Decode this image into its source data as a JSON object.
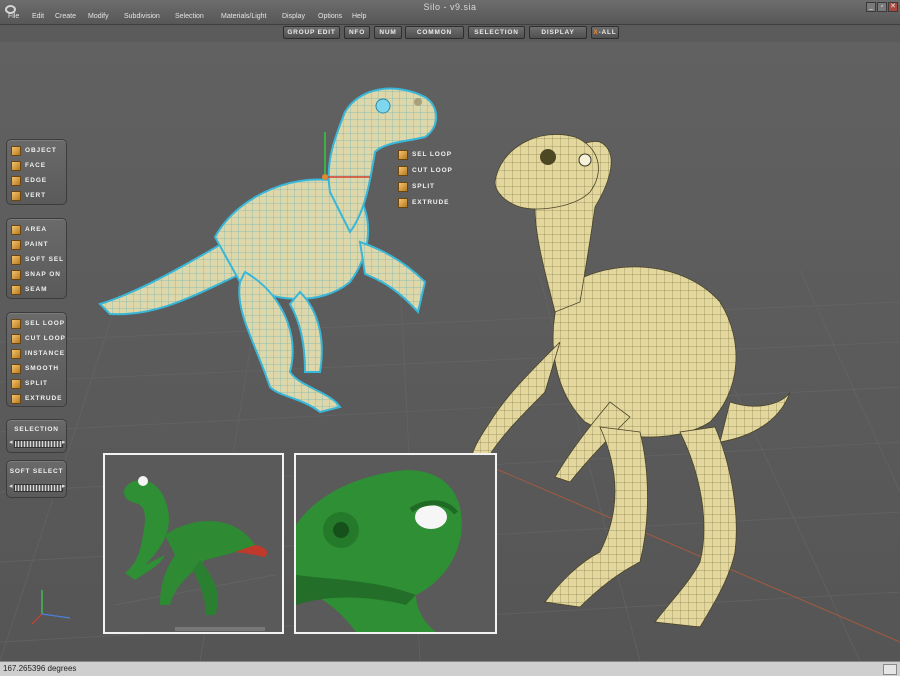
{
  "window": {
    "title": "Silo - v9.sia",
    "minimize": "_",
    "restore": "▫",
    "close": "✕"
  },
  "menu": [
    "File",
    "Edit",
    "Create",
    "Modify",
    "Subdivision",
    "Selection",
    "Materials/Light",
    "Display",
    "Options",
    "Help"
  ],
  "toolbar": {
    "group_edit": "GROUP EDIT",
    "info": "NFO",
    "num": "NUM",
    "common": "COMMON",
    "selection": "SELECTION",
    "display": "DISPLAY",
    "x_all_prefix": "X",
    "x_all_suffix": "-ALL"
  },
  "panels": {
    "modes": [
      "OBJECT",
      "FACE",
      "EDGE",
      "VERT"
    ],
    "select_tools": [
      "AREA",
      "PAINT",
      "SOFT SEL",
      "SNAP ON",
      "SEAM"
    ],
    "edit_tools": [
      "SEL LOOP",
      "CUT LOOP",
      "INSTANCE",
      "SMOOTH",
      "SPLIT",
      "EXTRUDE"
    ],
    "selection_label": "SELECTION",
    "soft_select_label": "SOFT SELECT",
    "slider_left": "◂",
    "slider_right": "▸"
  },
  "context_tools": [
    "SEL LOOP",
    "CUT LOOP",
    "SPLIT",
    "EXTRUDE"
  ],
  "status": {
    "text": "167.265396 degrees"
  },
  "colors": {
    "model_base": "#e3d9a3",
    "model_wire": "#3f3a20",
    "selected_wire": "#39b7d9",
    "render_green": "#2f8f35",
    "icon_orange": "#e0a040"
  }
}
